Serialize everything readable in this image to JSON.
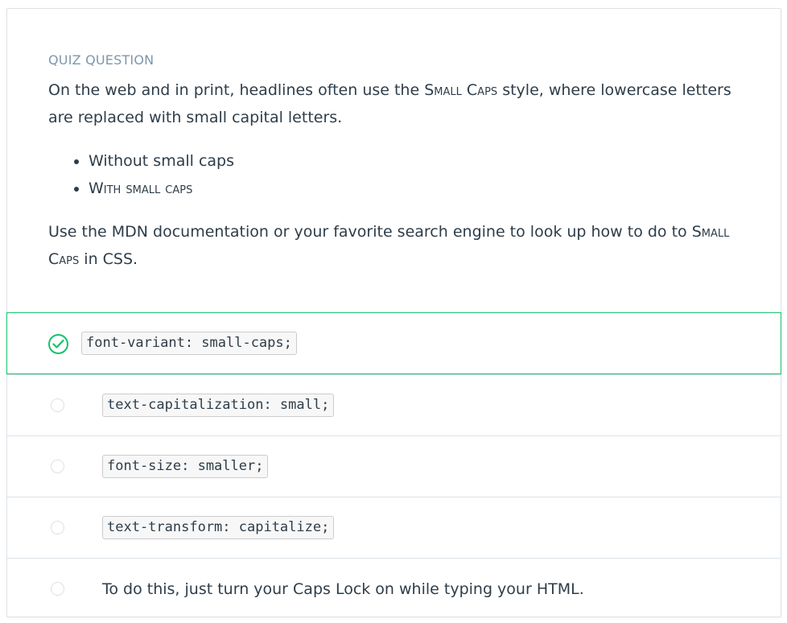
{
  "quiz": {
    "kicker": "Quiz Question",
    "intro_before": "On the web and in print, headlines often use the ",
    "intro_sc": "Small Caps",
    "intro_after": " style, where lowercase letters are replaced with small capital letters.",
    "examples": [
      "Without small caps",
      "With small caps"
    ],
    "instruction_before": "Use the MDN documentation or your favorite search engine to look up how to do to ",
    "instruction_sc": "Small Caps",
    "instruction_after": " in CSS."
  },
  "options": [
    {
      "label": "font-variant: small-caps;",
      "type": "code",
      "selected": true
    },
    {
      "label": "text-capitalization: small;",
      "type": "code",
      "selected": false
    },
    {
      "label": "font-size: smaller;",
      "type": "code",
      "selected": false
    },
    {
      "label": "text-transform: capitalize;",
      "type": "code",
      "selected": false
    },
    {
      "label": "To do this, just turn your Caps Lock on while typing your HTML.",
      "type": "text",
      "selected": false
    }
  ],
  "colors": {
    "correct": "#15c26b",
    "kicker": "#7d97ad",
    "text": "#2e3d49",
    "border": "#dbe2e8"
  },
  "icons": {
    "selected": "check-circle-icon",
    "unselected": "radio-circle-icon"
  }
}
